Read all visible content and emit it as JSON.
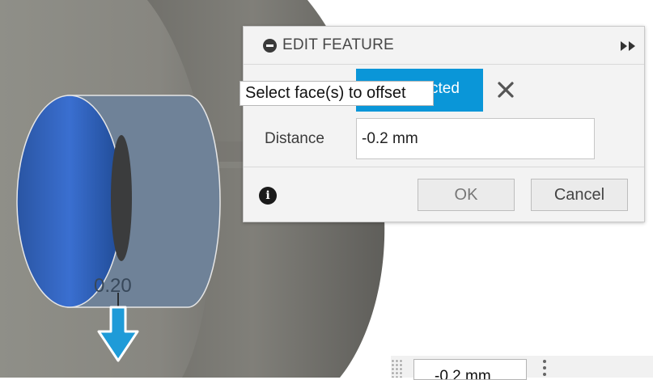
{
  "panel": {
    "title": "EDIT FEATURE",
    "selection_label": "cted",
    "distance_label": "Distance",
    "distance_value": "-0.2 mm",
    "ok_label": "OK",
    "cancel_label": "Cancel"
  },
  "tooltip": {
    "text": "Select face(s) to offset"
  },
  "canvas": {
    "dimension_label": "0.20"
  },
  "mini_toolbar": {
    "value": "-0.2 mm"
  },
  "colors": {
    "accent": "#0a96d8",
    "face_blue": "#2f62b8",
    "body_gray": "#8d8d86"
  },
  "icons": [
    "collapse-icon",
    "expand-icon",
    "clear-selection-icon",
    "info-icon",
    "offset-arrow-icon",
    "more-options-icon",
    "drag-grip-icon"
  ]
}
